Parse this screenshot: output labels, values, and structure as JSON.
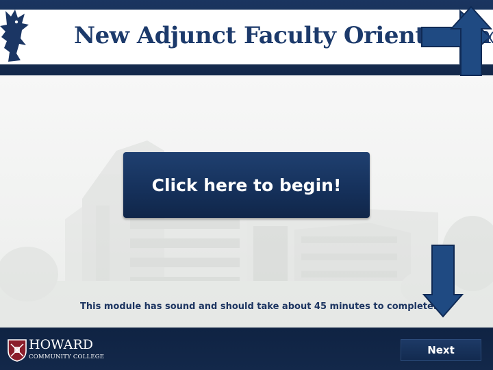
{
  "header": {
    "title": "New Adjunct Faculty Orientation",
    "close_glyph": "X",
    "mascot_icon": "mascot-icon"
  },
  "main": {
    "begin_label": "Click here to begin!",
    "info": "This module has sound and should take about 45 minutes to complete."
  },
  "footer": {
    "college_name": "HOWARD",
    "college_sub": "COMMUNITY COLLEGE",
    "next_label": "Next"
  },
  "colors": {
    "brand_navy": "#14284b",
    "title_blue": "#1c3a6b",
    "arrow_blue": "#1f4a82"
  }
}
